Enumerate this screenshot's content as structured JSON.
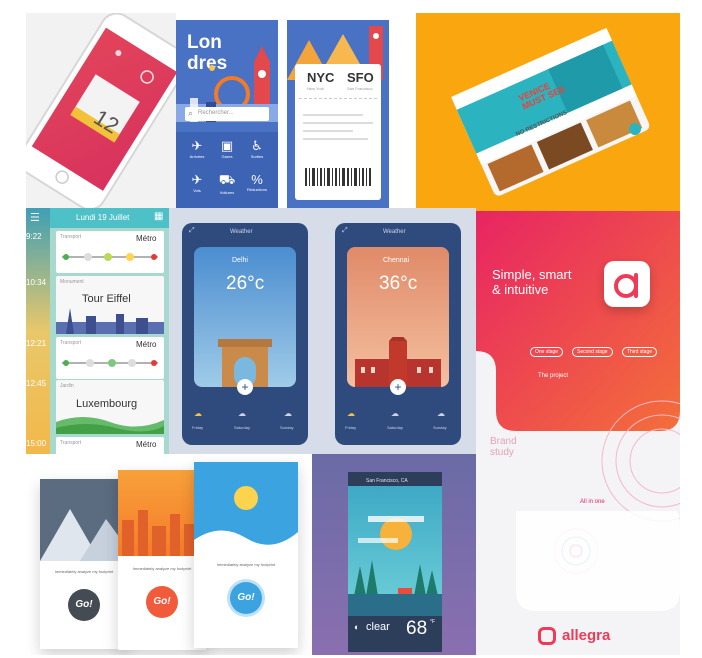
{
  "calendar": {
    "number": "12"
  },
  "london": {
    "title_line1": "Lon",
    "title_line2": "dres",
    "search": "Rechercher...",
    "grid_labels": [
      "Arrivées",
      "Gares",
      "Sorties",
      "Vols",
      "Voitures",
      "Réductions"
    ]
  },
  "ticket": {
    "from": "NYC",
    "to": "SFO",
    "from_city": "New York",
    "to_city": "San Francisco"
  },
  "travel_phone": {
    "hero_line1": "VENICE",
    "hero_line2": "MUST SEE",
    "section": "NO RESTRICTIONS"
  },
  "metro": {
    "header": "Lundi 19 Juillet",
    "times": [
      "9:22",
      "10:34",
      "12:21",
      "12:45",
      "15:00"
    ],
    "rows": [
      {
        "label": "Transport",
        "value": "Métro"
      },
      {
        "label": "Monument",
        "value": "Tour Eiffel"
      },
      {
        "label": "Transport",
        "value": "Métro"
      },
      {
        "label": "Jardin",
        "value": "Luxembourg"
      },
      {
        "label": "Transport",
        "value": "Métro"
      }
    ]
  },
  "weather": {
    "title": "Weather",
    "cards": [
      {
        "city": "Delhi",
        "temp": "26°c"
      },
      {
        "city": "Chennai",
        "temp": "36°c"
      }
    ],
    "day_labels": [
      "Friday",
      "Saturday",
      "Sunday"
    ]
  },
  "allegra": {
    "tagline_line1": "Simple, smart",
    "tagline_line2": "& intuitive",
    "project": "The project",
    "brand_study_line1": "Brand",
    "brand_study_line2": "study",
    "all_in_one": "All in one",
    "logo": "allegra",
    "pills": [
      "One stage",
      "Second stage",
      "Third stage"
    ]
  },
  "go": {
    "button": "Go!",
    "caption": "Immediately analyze my footprint"
  },
  "forecast": {
    "header": "San Francisco, CA",
    "condition": "clear",
    "temp": "68",
    "unit": "°F"
  },
  "colors": {
    "orange": "#f9a60f",
    "allegra_pink": "#e82463",
    "allegra_orange": "#f36f3a",
    "weather_navy": "#2f4a7d",
    "metro_teal": "#4ec0c8"
  }
}
